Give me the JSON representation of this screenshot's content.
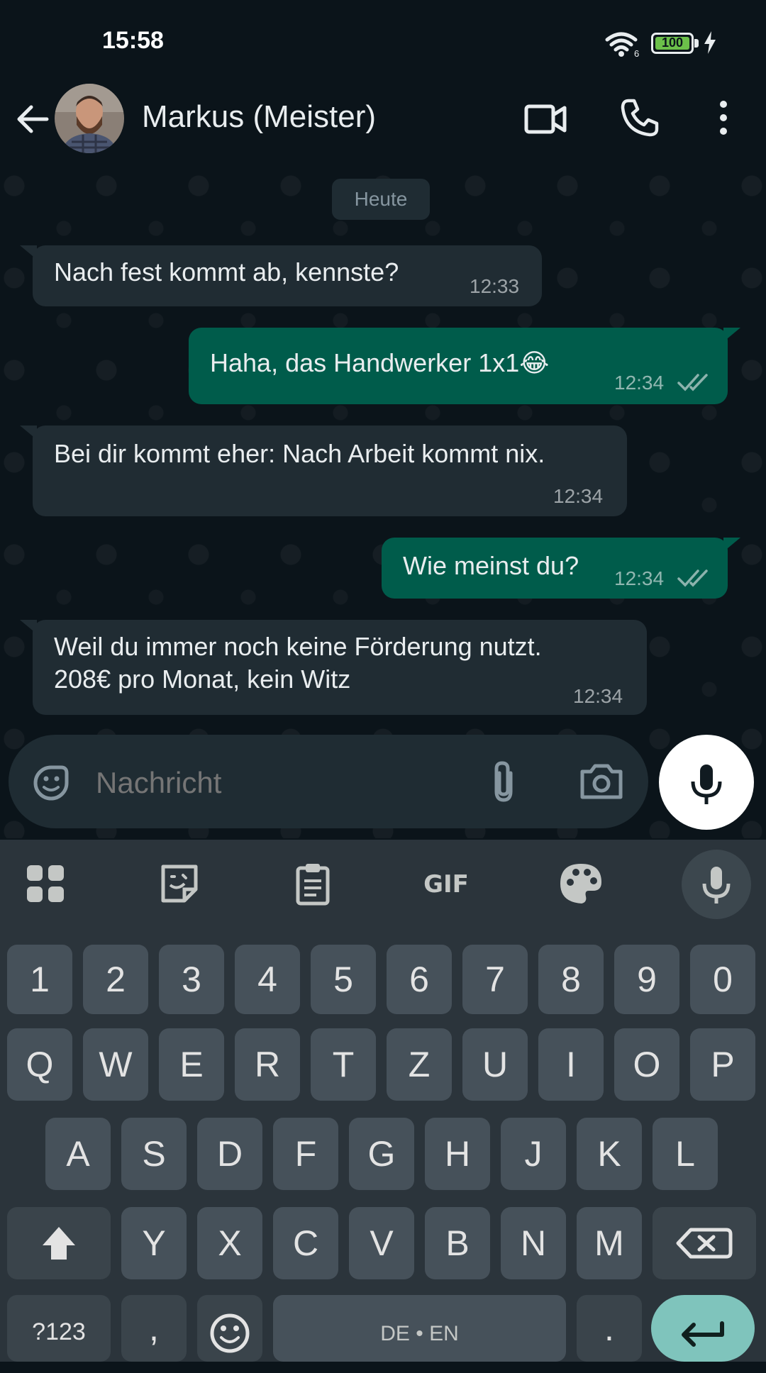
{
  "status_bar": {
    "time": "15:58",
    "battery_level": "100",
    "wifi_badge": "6"
  },
  "header": {
    "contact_name": "Markus (Meister)"
  },
  "chat": {
    "date_divider": "Heute",
    "messages": [
      {
        "direction": "incoming",
        "lines": [
          "Nach fest kommt ab, kennste?"
        ],
        "time": "12:33"
      },
      {
        "direction": "outgoing",
        "lines": [
          "Haha, das Handwerker 1x1😂"
        ],
        "time": "12:34",
        "status": "read"
      },
      {
        "direction": "incoming",
        "lines": [
          "Bei dir kommt eher: Nach Arbeit kommt nix."
        ],
        "time": "12:34"
      },
      {
        "direction": "outgoing",
        "lines": [
          "Wie meinst du?"
        ],
        "time": "12:34",
        "status": "read"
      },
      {
        "direction": "incoming",
        "lines": [
          "Weil du immer noch keine Förderung nutzt.",
          "208€ pro Monat, kein Witz"
        ],
        "time": "12:34"
      }
    ]
  },
  "input": {
    "placeholder": "Nachricht"
  },
  "keyboard": {
    "toolbar": [
      "apps-grid-icon",
      "sticker-icon",
      "clipboard-icon",
      "GIF",
      "palette-icon",
      "mic-icon"
    ],
    "gif_label": "GIF",
    "row_numbers": [
      "1",
      "2",
      "3",
      "4",
      "5",
      "6",
      "7",
      "8",
      "9",
      "0"
    ],
    "row_top": [
      "Q",
      "W",
      "E",
      "R",
      "T",
      "Z",
      "U",
      "I",
      "O",
      "P"
    ],
    "row_middle": [
      "A",
      "S",
      "D",
      "F",
      "G",
      "H",
      "J",
      "K",
      "L"
    ],
    "row_bottom": [
      "Y",
      "X",
      "C",
      "V",
      "B",
      "N",
      "M"
    ],
    "symbols_key": "?123",
    "comma_key": ",",
    "space_label": "DE • EN",
    "period_key": "."
  },
  "colors": {
    "background": "#0b141a",
    "incoming_bubble": "#202c33",
    "outgoing_bubble": "#005c4b",
    "keyboard_bg": "#2b343b",
    "key_bg": "#46515a",
    "enter_key": "#7fc4bc"
  }
}
